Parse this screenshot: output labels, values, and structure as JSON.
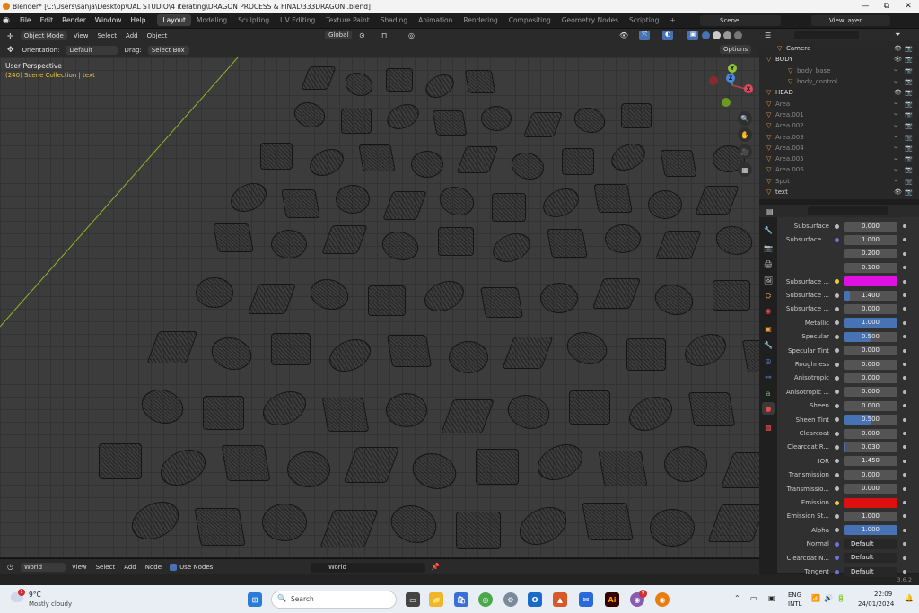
{
  "titlebar": {
    "title": "Blender* [C:\\Users\\sanja\\Desktop\\UAL STUDIO\\4 iterating\\DRAGON PROCESS & FINAL\\333DRAGON .blend]",
    "minimize": "—",
    "maximize": "⧉",
    "close": "✕"
  },
  "menu": [
    "File",
    "Edit",
    "Render",
    "Window",
    "Help"
  ],
  "workspaces": [
    "Layout",
    "Modeling",
    "Sculpting",
    "UV Editing",
    "Texture Paint",
    "Shading",
    "Animation",
    "Rendering",
    "Compositing",
    "Geometry Nodes",
    "Scripting"
  ],
  "workspace_add": "+",
  "scene": {
    "label": "Scene",
    "viewlayer": "ViewLayer"
  },
  "viewport_header": {
    "mode": "Object Mode",
    "menu": [
      "View",
      "Select",
      "Add",
      "Object"
    ],
    "transform": "Global",
    "orientation_label": "Orientation:",
    "orientation": "Default",
    "drag_label": "Drag:",
    "drag": "Select Box",
    "options": "Options"
  },
  "viewport": {
    "view_name": "User Perspective",
    "collection": "(240) Scene Collection | text"
  },
  "gizmo": {
    "x": "X",
    "y": "Y",
    "z": "Z"
  },
  "node_header": {
    "world_type": "World",
    "menu": [
      "View",
      "Select",
      "Add",
      "Node"
    ],
    "use_nodes": "Use Nodes",
    "world_name": "World"
  },
  "outliner": {
    "rows": [
      {
        "name": "Camera",
        "hidden": false
      },
      {
        "name": "BODY",
        "hidden": false
      },
      {
        "name": "body_base",
        "hidden": true
      },
      {
        "name": "body_control",
        "hidden": true
      },
      {
        "name": "HEAD",
        "hidden": false
      },
      {
        "name": "Area",
        "hidden": true
      },
      {
        "name": "Area.001",
        "hidden": true
      },
      {
        "name": "Area.002",
        "hidden": true
      },
      {
        "name": "Area.003",
        "hidden": true
      },
      {
        "name": "Area.004",
        "hidden": true
      },
      {
        "name": "Area.005",
        "hidden": true
      },
      {
        "name": "Area.006",
        "hidden": true
      },
      {
        "name": "Spot",
        "hidden": true
      },
      {
        "name": "text",
        "hidden": false
      }
    ]
  },
  "properties": {
    "rows": [
      {
        "label": "Subsurface",
        "value": "0.000",
        "dot": "w",
        "fill": 0
      },
      {
        "label": "Subsurface ...",
        "value": "1.000",
        "dot": "b",
        "fill": 0
      },
      {
        "label": "",
        "value": "0.200",
        "dot": "",
        "fill": 0
      },
      {
        "label": "",
        "value": "0.100",
        "dot": "",
        "fill": 0
      },
      {
        "label": "Subsurface ...",
        "value": "",
        "dot": "y",
        "fill": 0,
        "color": "#e010e0"
      },
      {
        "label": "Subsurface ...",
        "value": "1.400",
        "dot": "w",
        "fill": 0.12
      },
      {
        "label": "Subsurface ...",
        "value": "0.000",
        "dot": "w",
        "fill": 0
      },
      {
        "label": "Metallic",
        "value": "1.000",
        "dot": "w",
        "fill": 1
      },
      {
        "label": "Specular",
        "value": "0.500",
        "dot": "w",
        "fill": 0.5
      },
      {
        "label": "Specular Tint",
        "value": "0.000",
        "dot": "w",
        "fill": 0
      },
      {
        "label": "Roughness",
        "value": "0.000",
        "dot": "w",
        "fill": 0
      },
      {
        "label": "Anisotropic",
        "value": "0.000",
        "dot": "w",
        "fill": 0
      },
      {
        "label": "Anisotropic ...",
        "value": "0.000",
        "dot": "w",
        "fill": 0
      },
      {
        "label": "Sheen",
        "value": "0.000",
        "dot": "w",
        "fill": 0
      },
      {
        "label": "Sheen Tint",
        "value": "0.500",
        "dot": "w",
        "fill": 0.5
      },
      {
        "label": "Clearcoat",
        "value": "0.000",
        "dot": "w",
        "fill": 0
      },
      {
        "label": "Clearcoat R...",
        "value": "0.030",
        "dot": "w",
        "fill": 0.03
      },
      {
        "label": "IOR",
        "value": "1.450",
        "dot": "w",
        "fill": 0
      },
      {
        "label": "Transmission",
        "value": "0.000",
        "dot": "w",
        "fill": 0
      },
      {
        "label": "Transmissio...",
        "value": "0.000",
        "dot": "w",
        "fill": 0
      },
      {
        "label": "Emission",
        "value": "",
        "dot": "y",
        "fill": 0,
        "color": "#dd1010"
      },
      {
        "label": "Emission St...",
        "value": "1.000",
        "dot": "w",
        "fill": 0
      },
      {
        "label": "Alpha",
        "value": "1.000",
        "dot": "w",
        "fill": 1
      },
      {
        "label": "Normal",
        "value": "Default",
        "dot": "b",
        "fill": 0,
        "link": true
      },
      {
        "label": "Clearcoat N...",
        "value": "Default",
        "dot": "b",
        "fill": 0,
        "link": true
      },
      {
        "label": "Tangent",
        "value": "Default",
        "dot": "b",
        "fill": 0,
        "link": true
      }
    ]
  },
  "status": {
    "version": "3.6.2"
  },
  "taskbar": {
    "temp": "9°C",
    "weather": "Mostly cloudy",
    "search": "Search",
    "lang1": "ENG",
    "lang2": "INTL",
    "time": "22:09",
    "date": "24/01/2024",
    "weather_badge": "1",
    "notif_badge": "9"
  }
}
